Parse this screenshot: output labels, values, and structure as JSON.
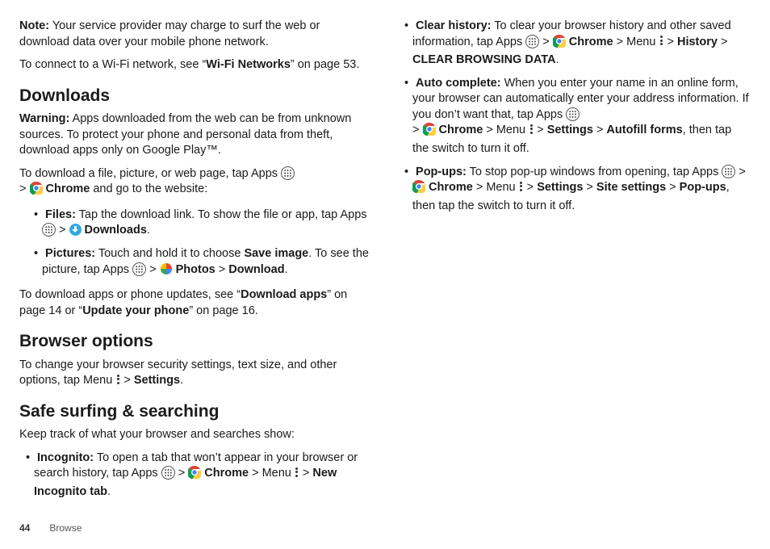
{
  "left": {
    "noteLabel": "Note:",
    "noteText": " Your service provider may charge to surf the web or download data over your mobile phone network.",
    "wifi1": "To connect to a Wi-Fi network, see “",
    "wifiBold": "Wi-Fi Networks",
    "wifi2": "” on page 53.",
    "hDownloads": "Downloads",
    "warnLabel": "Warning:",
    "warnText": " Apps downloaded from the web can be from unknown sources. To protect your phone and personal data from theft, download apps only on Google Play™.",
    "dl1a": "To download a file, picture, or web page, tap Apps ",
    "dl1b": " > ",
    "dlChrome": " Chrome",
    "dl1c": " and go to the website:",
    "filesLabel": "Files:",
    "files1": " Tap the download link. To show the file or app, tap Apps ",
    "filesGt": " > ",
    "filesDownloads": " Downloads",
    "filesEnd": ".",
    "picsLabel": "Pictures:",
    "pics1": " Touch and hold it to choose ",
    "picsSave": "Save image",
    "pics2": ". To see the picture, tap Apps ",
    "picsGt": " > ",
    "picsPhotos": " Photos",
    "picsGt2": " > ",
    "picsDownload": "Download",
    "picsEnd": ".",
    "dlapps1": "To download apps or phone updates, see “",
    "dlappsBold": "Download apps",
    "dlapps2": "” on page 14 or “",
    "dlappsBold2": "Update your phone",
    "dlapps3": "” on page 16.",
    "hBrowser": "Browser options",
    "bo1": "To change your browser security settings, text size, and other options, tap Menu ",
    "boGt": " > ",
    "boSettings": "Settings",
    "boEnd": ".",
    "hSafe": "Safe surfing & searching",
    "safeIntro": "Keep track of what your browser and searches show:",
    "incogLabel": "Incognito:",
    "incog1": " To open a tab that won’t appear in your browser or search history, tap Apps ",
    "incogGt": " > ",
    "incogChrome": " Chrome",
    "incogGt2": " > Menu ",
    "incogGt3": " > ",
    "incogNew": "New Incognito tab",
    "incogEnd": "."
  },
  "right": {
    "clearLabel": "Clear history:",
    "clear1": " To clear your browser history and other saved information, tap Apps ",
    "clearGt": " > ",
    "clearChrome": " Chrome",
    "clearGt2": " > Menu ",
    "clearGt3": " > ",
    "clearHistory": "History",
    "clearGt4": " > ",
    "clearData": "CLEAR BROWSING DATA",
    "clearEnd": ".",
    "autoLabel": "Auto complete:",
    "auto1": " When you enter your name in an online form, your browser can automatically enter your address information. If you don’t want that, tap Apps ",
    "autoGt": " > ",
    "autoChrome": " Chrome",
    "autoGt2": " > Menu ",
    "autoGt3": " > ",
    "autoSettings": "Settings",
    "autoGt4": " > ",
    "autoForms": "Autofill forms",
    "auto2": ", then tap the switch to turn it off.",
    "popLabel": "Pop-ups:",
    "pop1": " To stop pop-up windows from opening, tap Apps ",
    "popGt": " > ",
    "popChrome": " Chrome",
    "popGt2": " > Menu ",
    "popGt3": " > ",
    "popSettings": "Settings",
    "popGt4": " > ",
    "popSite": "Site settings",
    "popGt5": " > ",
    "popPopups": "Pop-ups",
    "pop2": ", then tap the switch to turn it off."
  },
  "footer": {
    "page": "44",
    "section": "Browse"
  }
}
